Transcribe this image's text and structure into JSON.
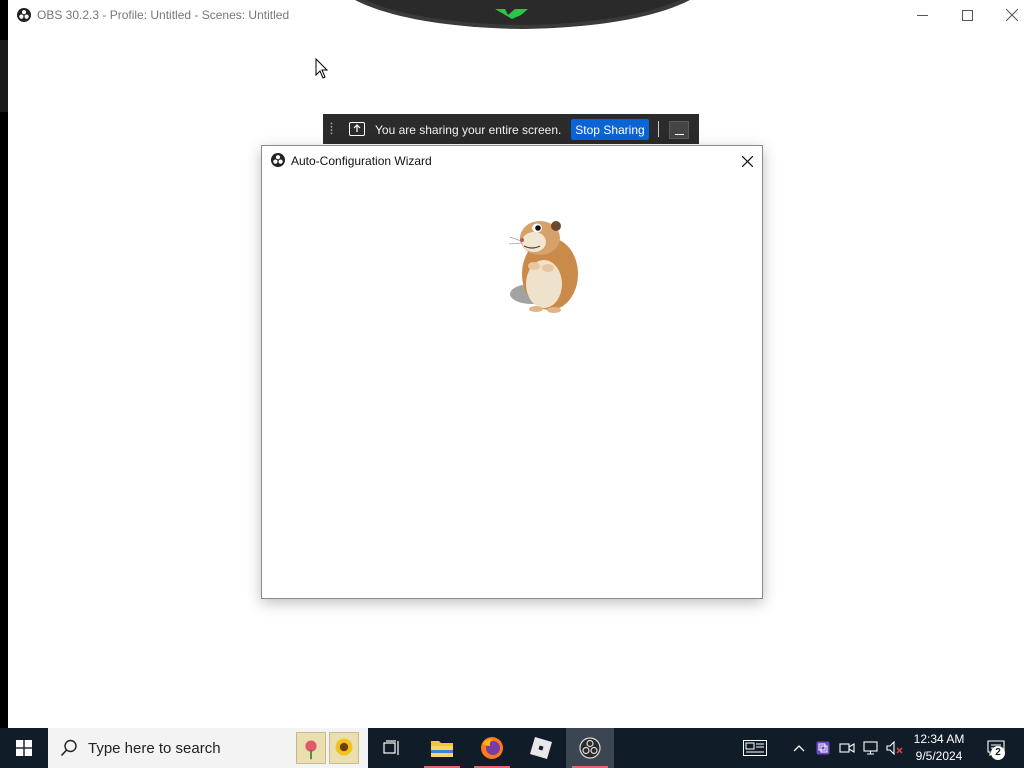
{
  "obs_window": {
    "title": "OBS 30.2.3 - Profile: Untitled - Scenes: Untitled",
    "controls": [
      "minimize-icon",
      "maximize-icon",
      "close-icon"
    ]
  },
  "share_bar": {
    "message": "You are sharing your entire screen.",
    "stop_label": "Stop Sharing"
  },
  "wizard": {
    "title": "Auto-Configuration Wizard",
    "image": "hamster-illustration"
  },
  "taskbar": {
    "search_placeholder": "Type here to search",
    "pinned_apps": [
      "task-view-icon",
      "file-explorer-icon",
      "firefox-icon",
      "roblox-icon",
      "obs-icon"
    ],
    "clock_time": "12:34 AM",
    "clock_date": "9/5/2024",
    "notification_count": "2"
  },
  "colors": {
    "stop_button": "#0a64d6",
    "share_bar_bg": "#2b2b2b",
    "taskbar_bg": "#101c28"
  }
}
